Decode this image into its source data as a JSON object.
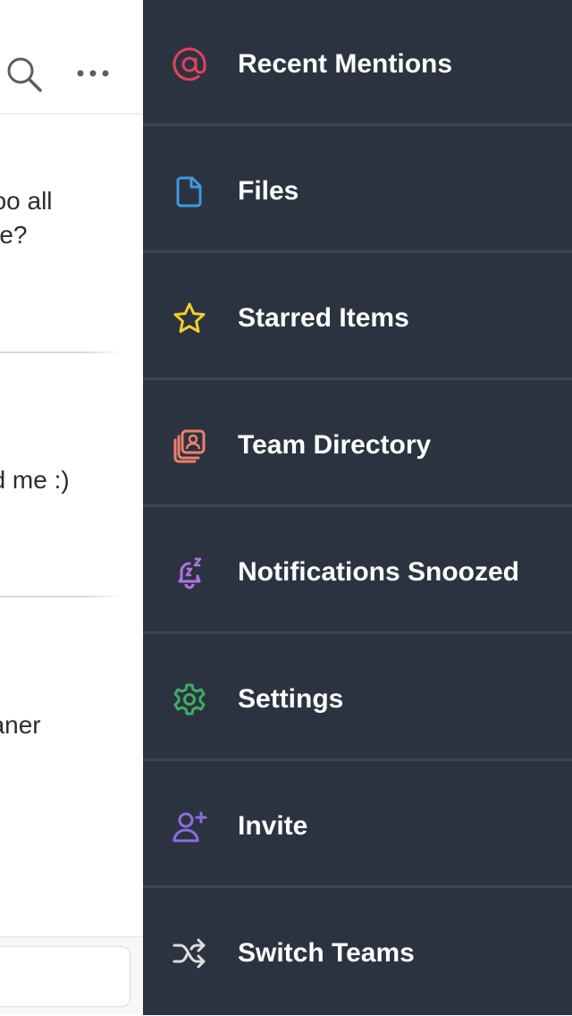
{
  "chat": {
    "messages": [
      {
        "lines": [
          "boo all",
          "me?"
        ]
      },
      {
        "lines": [
          "ed me :)"
        ]
      },
      {
        "lines": [
          "eaner"
        ]
      }
    ]
  },
  "menu": {
    "items": [
      {
        "label": "Recent Mentions",
        "icon": "at-icon",
        "color": "#e0435a"
      },
      {
        "label": "Files",
        "icon": "file-icon",
        "color": "#3b9ae1"
      },
      {
        "label": "Starred Items",
        "icon": "star-icon",
        "color": "#f4cf2a"
      },
      {
        "label": "Team Directory",
        "icon": "team-directory-icon",
        "color": "#ef7f6a"
      },
      {
        "label": "Notifications Snoozed",
        "icon": "snooze-bell-icon",
        "color": "#b272e8"
      },
      {
        "label": "Settings",
        "icon": "gear-icon",
        "color": "#3fae64"
      },
      {
        "label": "Invite",
        "icon": "add-user-icon",
        "color": "#8d6ce0"
      },
      {
        "label": "Switch Teams",
        "icon": "shuffle-icon",
        "color": "#dddddd"
      }
    ]
  }
}
